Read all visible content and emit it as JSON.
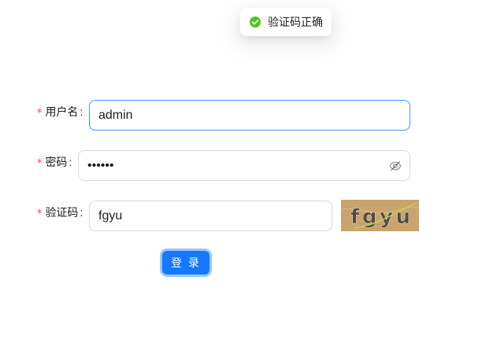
{
  "toast": {
    "icon": "check-circle-icon",
    "message": "验证码正确"
  },
  "form": {
    "required_mark": "*",
    "colon": ":",
    "username": {
      "label": "用户名",
      "value": "admin",
      "focused": true
    },
    "password": {
      "label": "密码",
      "value": "••••••",
      "toggle_icon": "eye-invisible-icon"
    },
    "captcha": {
      "label": "验证码",
      "value": "fgyu",
      "image_text": "fgyu"
    },
    "submit_label": "登 录"
  },
  "colors": {
    "primary": "#1677ff",
    "focus_border": "#4096ff",
    "focus_ring": "#91caff",
    "required": "#ff4d4f",
    "success": "#52c41a",
    "captcha_bg": "#c9a46f",
    "captcha_text": "#524c45",
    "captcha_line": "#bfd156"
  }
}
